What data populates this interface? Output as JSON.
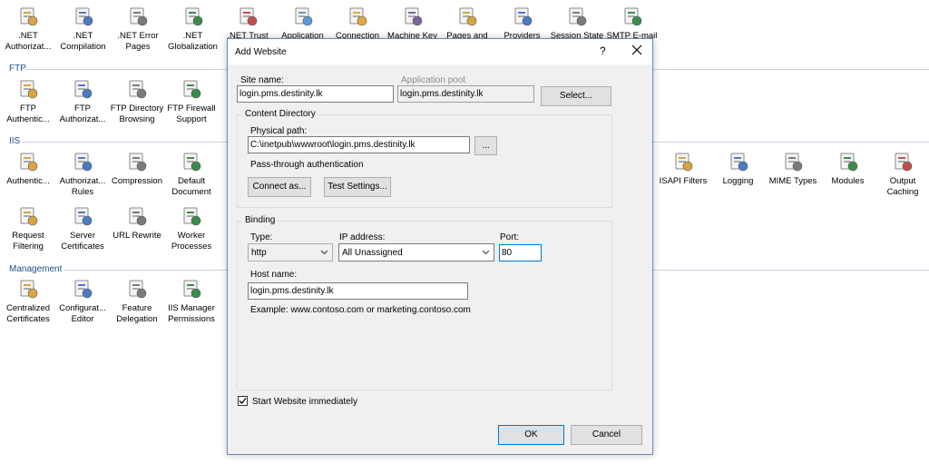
{
  "background": {
    "sections": {
      "ftp": "FTP",
      "iis": "IIS",
      "management": "Management"
    },
    "row_aspnet": [
      {
        "icon": "aspnet-authorization-icon",
        "label1": ".NET",
        "label2": "Authorizat..."
      },
      {
        "icon": "aspnet-compilation-icon",
        "label1": ".NET",
        "label2": "Compilation"
      },
      {
        "icon": "aspnet-error-pages-icon",
        "label1": ".NET Error",
        "label2": "Pages"
      },
      {
        "icon": "aspnet-globalization-icon",
        "label1": ".NET",
        "label2": "Globalization"
      },
      {
        "icon": "aspnet-trust-icon",
        "label1": ".NET Trust",
        "label2": ""
      },
      {
        "icon": "application-settings-icon",
        "label1": "Application",
        "label2": ""
      },
      {
        "icon": "connection-strings-icon",
        "label1": "Connection",
        "label2": ""
      },
      {
        "icon": "machine-key-icon",
        "label1": "Machine Key",
        "label2": ""
      },
      {
        "icon": "pages-controls-icon",
        "label1": "Pages and",
        "label2": ""
      },
      {
        "icon": "providers-icon",
        "label1": "Providers",
        "label2": ""
      },
      {
        "icon": "session-state-icon",
        "label1": "Session State",
        "label2": ""
      },
      {
        "icon": "smtp-email-icon",
        "label1": "SMTP E-mail",
        "label2": ""
      }
    ],
    "row_ftp": [
      {
        "icon": "ftp-authentication-icon",
        "label1": "FTP",
        "label2": "Authentic..."
      },
      {
        "icon": "ftp-authorization-icon",
        "label1": "FTP",
        "label2": "Authorizat..."
      },
      {
        "icon": "ftp-directory-browsing-icon",
        "label1": "FTP Directory",
        "label2": "Browsing"
      },
      {
        "icon": "ftp-firewall-support-icon",
        "label1": "FTP Firewall",
        "label2": "Support"
      }
    ],
    "row_iis_left": [
      {
        "icon": "authentication-icon",
        "label1": "Authentic...",
        "label2": ""
      },
      {
        "icon": "authorization-rules-icon",
        "label1": "Authorizat...",
        "label2": "Rules"
      },
      {
        "icon": "compression-icon",
        "label1": "Compression",
        "label2": ""
      },
      {
        "icon": "default-document-icon",
        "label1": "Default",
        "label2": "Document"
      }
    ],
    "row_iis_right": [
      {
        "icon": "isapi-filters-icon",
        "label1": "ISAPI Filters",
        "label2": ""
      },
      {
        "icon": "logging-icon",
        "label1": "Logging",
        "label2": ""
      },
      {
        "icon": "mime-types-icon",
        "label1": "MIME Types",
        "label2": ""
      },
      {
        "icon": "modules-icon",
        "label1": "Modules",
        "label2": ""
      },
      {
        "icon": "output-caching-icon",
        "label1": "Output",
        "label2": "Caching"
      }
    ],
    "row_iis2": [
      {
        "icon": "request-filtering-icon",
        "label1": "Request",
        "label2": "Filtering"
      },
      {
        "icon": "server-certificates-icon",
        "label1": "Server",
        "label2": "Certificates"
      },
      {
        "icon": "url-rewrite-icon",
        "label1": "URL Rewrite",
        "label2": ""
      },
      {
        "icon": "worker-processes-icon",
        "label1": "Worker",
        "label2": "Processes"
      }
    ],
    "row_mgmt": [
      {
        "icon": "centralized-certificates-icon",
        "label1": "Centralized",
        "label2": "Certificates"
      },
      {
        "icon": "configuration-editor-icon",
        "label1": "Configurat...",
        "label2": "Editor"
      },
      {
        "icon": "feature-delegation-icon",
        "label1": "Feature",
        "label2": "Delegation"
      },
      {
        "icon": "iis-manager-permissions-icon",
        "label1": "IIS Manager",
        "label2": "Permissions"
      }
    ],
    "colors": {
      "section_header": "#1e4e8c",
      "dialog_bg": "#f0f0f0",
      "focus_blue": "#0078d7"
    }
  },
  "dialog": {
    "title": "Add Website",
    "help_label": "?",
    "site_name_label": "Site name:",
    "site_name_value": "login.pms.destinity.lk",
    "app_pool_label": "Application pool:",
    "app_pool_value": "login.pms.destinity.lk",
    "select_button": "Select...",
    "content_directory": {
      "group_title": "Content Directory",
      "physical_path_label": "Physical path:",
      "physical_path_value": "C:\\inetpub\\wwwroot\\login.pms.destinity.lk",
      "browse_button": "...",
      "passthrough_label": "Pass-through authentication",
      "connect_as_button": "Connect as...",
      "test_settings_button": "Test Settings..."
    },
    "binding": {
      "group_title": "Binding",
      "type_label": "Type:",
      "type_value": "http",
      "ip_label": "IP address:",
      "ip_value": "All Unassigned",
      "port_label": "Port:",
      "port_value": "80",
      "host_name_label": "Host name:",
      "host_name_value": "login.pms.destinity.lk",
      "example_text": "Example: www.contoso.com or marketing.contoso.com"
    },
    "start_immediately_label": "Start Website immediately",
    "start_immediately_checked": true,
    "ok_button": "OK",
    "cancel_button": "Cancel"
  }
}
